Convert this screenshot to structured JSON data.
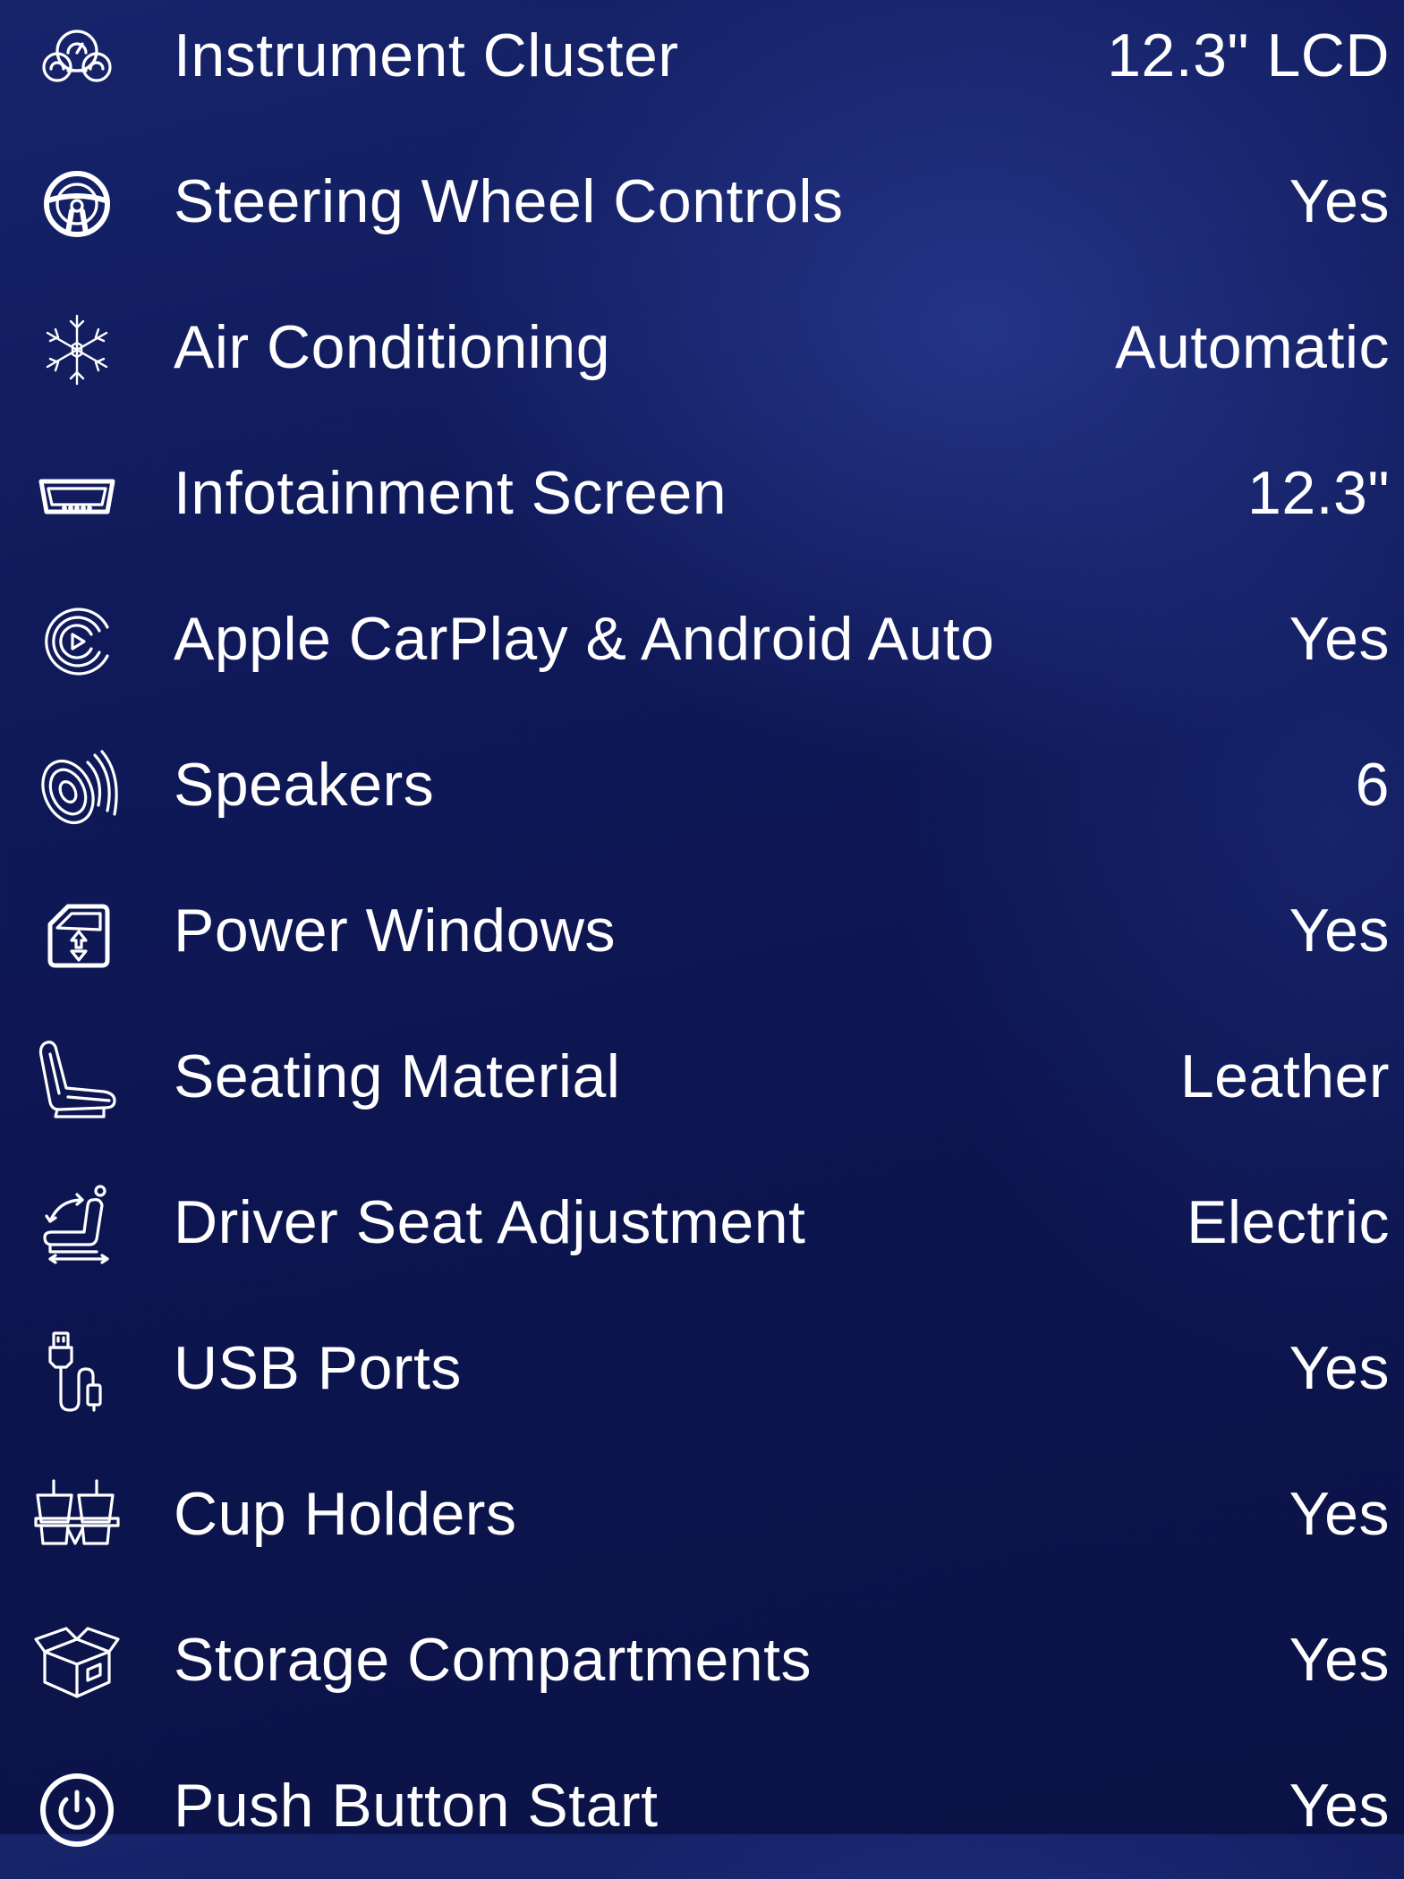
{
  "features": [
    {
      "icon": "instrument-cluster-icon",
      "label": "Instrument Cluster",
      "value": "12.3\" LCD"
    },
    {
      "icon": "steering-wheel-icon",
      "label": "Steering Wheel Controls",
      "value": "Yes"
    },
    {
      "icon": "snowflake-icon",
      "label": "Air Conditioning",
      "value": "Automatic"
    },
    {
      "icon": "screen-icon",
      "label": "Infotainment Screen",
      "value": "12.3\""
    },
    {
      "icon": "carplay-icon",
      "label": "Apple CarPlay & Android Auto",
      "value": "Yes"
    },
    {
      "icon": "speaker-icon",
      "label": "Speakers",
      "value": "6"
    },
    {
      "icon": "power-window-icon",
      "label": "Power Windows",
      "value": "Yes"
    },
    {
      "icon": "seat-icon",
      "label": "Seating Material",
      "value": "Leather"
    },
    {
      "icon": "seat-adjust-icon",
      "label": "Driver Seat Adjustment",
      "value": "Electric"
    },
    {
      "icon": "usb-icon",
      "label": "USB Ports",
      "value": "Yes"
    },
    {
      "icon": "cup-holder-icon",
      "label": "Cup Holders",
      "value": "Yes"
    },
    {
      "icon": "storage-box-icon",
      "label": "Storage Compartments",
      "value": "Yes"
    },
    {
      "icon": "power-button-icon",
      "label": "Push Button Start",
      "value": "Yes"
    }
  ]
}
